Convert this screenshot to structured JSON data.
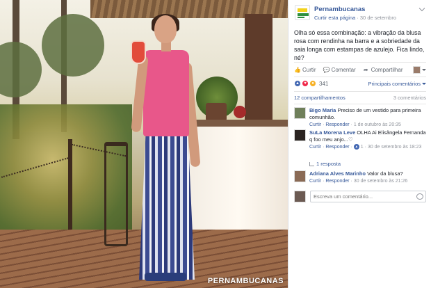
{
  "photo": {
    "watermark": "PERNAMBUCANAS"
  },
  "post": {
    "page_name": "Pernambucanas",
    "like_page_link": "Curtir esta página",
    "separator": "·",
    "date": "30 de setembro",
    "text": "Olha só essa combinação: a vibração da blusa rosa com rendinha na barra e a sobriedade da saia longa com estampas de azulejo. Fica lindo, né?"
  },
  "actions": {
    "like_label": "Curtir",
    "comment_label": "Comentar",
    "share_label": "Compartilhar"
  },
  "reactions": {
    "count": "341",
    "filter_label": "Principais comentários",
    "colors": {
      "like": "#4267b2",
      "love": "#f0284a",
      "wow": "#f7b125"
    }
  },
  "stats": {
    "shares": "12 compartilhamentos",
    "comments": "3 comentários"
  },
  "comments": [
    {
      "author": "Bigo Maria",
      "text": "Preciso de um vestido para primeira comunhão.",
      "like": "Curtir",
      "reply": "Responder",
      "date": "1 de outubro às 20:35"
    },
    {
      "author": "SuLa Morena Leve",
      "text": "OLHA Ai Elisângela Fernanda q foo meu anjo...♡",
      "like": "Curtir",
      "reply": "Responder",
      "likes": "1",
      "date": "30 de setembro às 18:23"
    },
    {
      "author": "Adriana Alves Marinho",
      "text": "Valor da blusa?",
      "like": "Curtir",
      "reply": "Responder",
      "date": "30 de setembro às 21:26"
    }
  ],
  "replies": {
    "label": "1 resposta"
  },
  "composer": {
    "placeholder": "Escreva um comentário..."
  }
}
